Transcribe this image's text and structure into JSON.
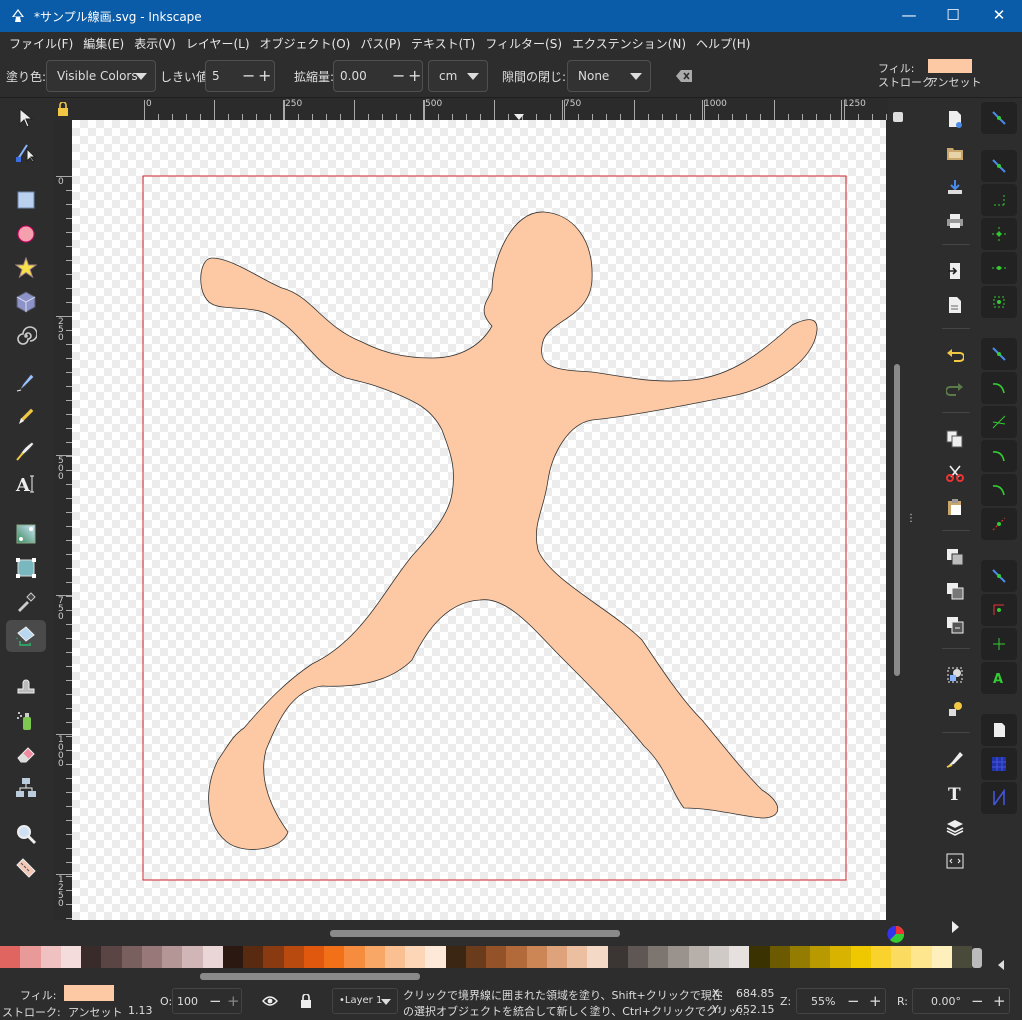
{
  "window": {
    "title": "*サンプル線画.svg - Inkscape",
    "controls": {
      "minimize": "—",
      "maximize": "☐",
      "close": "✕"
    }
  },
  "menu": [
    "ファイル(F)",
    "編集(E)",
    "表示(V)",
    "レイヤー(L)",
    "オブジェクト(O)",
    "パス(P)",
    "テキスト(T)",
    "フィルター(S)",
    "エクステンション(N)",
    "ヘルプ(H)"
  ],
  "tool_controls": {
    "fill_label": "塗り色:",
    "fill_value": "Visible Colors",
    "threshold_label": "しきい値:",
    "threshold_value": "5",
    "grow_label": "拡縮量:",
    "grow_value": "0.00",
    "unit_value": "cm",
    "close_gaps_label": "隙間の閉じ:",
    "close_gaps_value": "None",
    "style_fill_label": "フィル:",
    "style_stroke_label": "ストローク:",
    "style_stroke_value": "アンセット",
    "style_fill_color": "#fdc9a4"
  },
  "rulers": {
    "h": [
      "0",
      "250",
      "500",
      "750",
      "1000",
      "1250"
    ],
    "v": [
      "0",
      "250",
      "500",
      "750",
      "1000",
      "1250"
    ]
  },
  "palette": [
    "#e0645f",
    "#e89a98",
    "#efc1c0",
    "#f5dcdc",
    "#3a2b2b",
    "#5a4444",
    "#7a5f5f",
    "#987878",
    "#b49696",
    "#d0b6b6",
    "#ead6d6",
    "#2b1810",
    "#5a2a10",
    "#8a3a10",
    "#b84a10",
    "#e0580e",
    "#f27018",
    "#f58c3e",
    "#f8a766",
    "#fbc092",
    "#fdd6b8",
    "#fee8d8",
    "#3b2614",
    "#6a3c1c",
    "#935228",
    "#b26a3a",
    "#cc8656",
    "#dea37a",
    "#ebbfa0",
    "#f4dac6",
    "#3b3633",
    "#5e5753",
    "#7d7570",
    "#9a928d",
    "#b6afaa",
    "#d0cac6",
    "#e6e1de",
    "#3a3200",
    "#6b5a00",
    "#937c00",
    "#b89a00",
    "#d8b400",
    "#f0c800",
    "#fad22e",
    "#fcdc60",
    "#fde68e",
    "#fef0bc",
    "#4a4a3a"
  ],
  "statusbar": {
    "fill_label": "フィル:",
    "stroke_label": "ストローク:",
    "stroke_value": "アンセット",
    "stroke_width": "1.13",
    "fill_color": "#fdc9a4",
    "opacity_label": "O:",
    "opacity_value": "100",
    "layer": "•Layer 1",
    "message_line1": "クリックで境界線に囲まれた領域を塗り、Shift+クリックで現在",
    "message_line2": "の選択オブジェクトを統合して新しく塗り、Ctrl+クリックでクリッ...",
    "x_label": "X:",
    "x_value": "684.85",
    "y_label": "Y:",
    "y_value": "652.15",
    "zoom_label": "Z:",
    "zoom_value": "55%",
    "rotate_label": "R:",
    "rotate_value": "0.00°"
  }
}
